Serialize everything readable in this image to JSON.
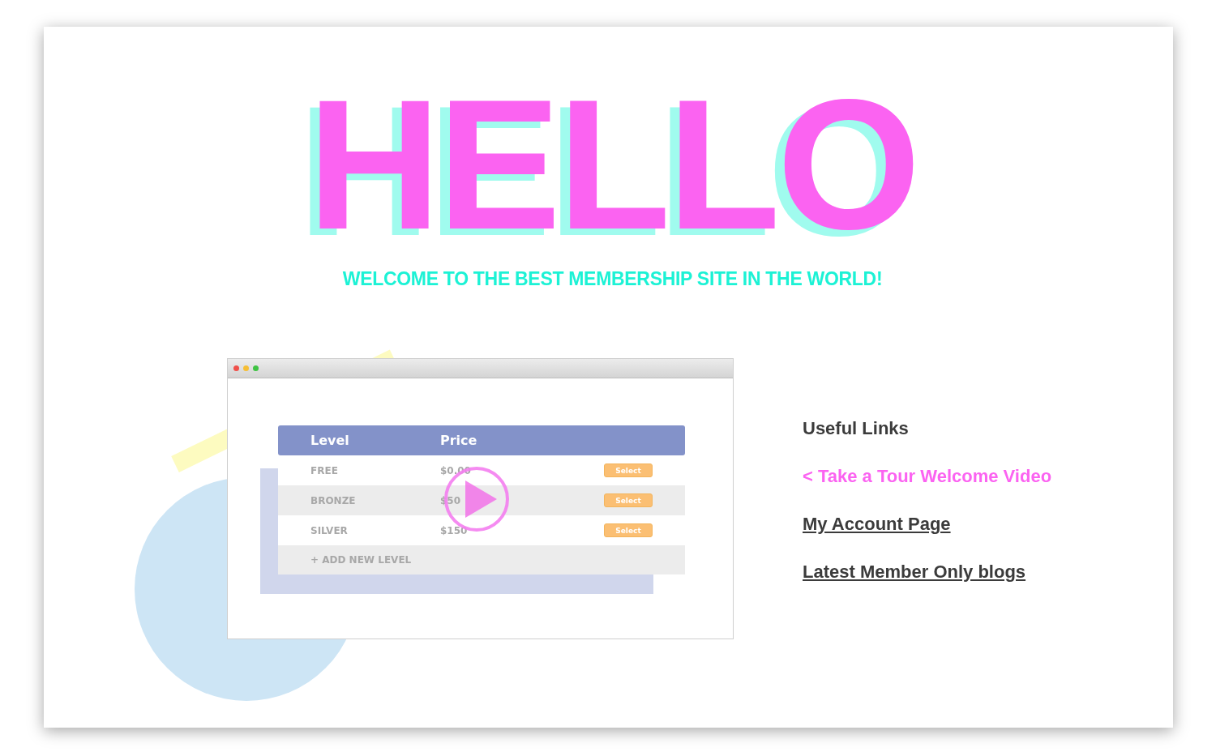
{
  "hero": {
    "title": "HELLO",
    "subtitle": "WELCOME TO THE BEST MEMBERSHIP SITE IN THE WORLD!"
  },
  "preview": {
    "columns": [
      "Level",
      "Price"
    ],
    "rows": [
      {
        "level": "FREE",
        "price": "$0.00",
        "button": "Select"
      },
      {
        "level": "BRONZE",
        "price": "$50",
        "button": "Select"
      },
      {
        "level": "SILVER",
        "price": "$150",
        "button": "Select"
      }
    ],
    "add_label": "+ ADD NEW LEVEL"
  },
  "links": {
    "heading": "Useful Links",
    "items": [
      {
        "label": "< Take a Tour Welcome Video",
        "selected": true
      },
      {
        "label": "My Account Page",
        "selected": false
      },
      {
        "label": "Latest Member Only blogs",
        "selected": false
      }
    ]
  }
}
